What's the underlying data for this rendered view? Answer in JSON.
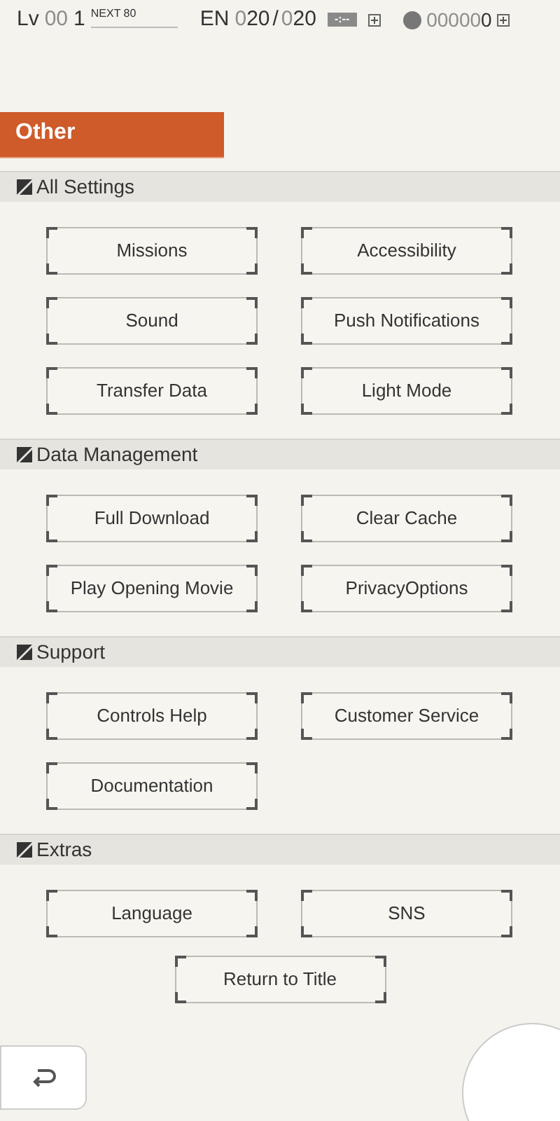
{
  "status_bar": {
    "lv_label": "Lv",
    "lv_faded": "00",
    "lv_value": "1",
    "next": "NEXT 80",
    "en_label": "EN",
    "en_faded": "0",
    "en_value": "20",
    "en_sep": "/",
    "en_max_faded": "0",
    "en_max": "20",
    "timer": "-:--",
    "coins_faded": "00000",
    "coins": "0"
  },
  "banner": {
    "title": "Other"
  },
  "sections": [
    {
      "title": "All Settings",
      "buttons": [
        "Missions",
        "Accessibility",
        "Sound",
        "Push Notifications",
        "Transfer Data",
        "Light Mode"
      ]
    },
    {
      "title": "Data Management",
      "buttons": [
        "Full Download",
        "Clear Cache",
        "Play Opening Movie",
        "PrivacyOptions"
      ]
    },
    {
      "title": "Support",
      "buttons": [
        "Controls Help",
        "Customer Service",
        "Documentation"
      ]
    },
    {
      "title": "Extras",
      "buttons": [
        "Language",
        "SNS"
      ]
    }
  ],
  "return_button": "Return to Title"
}
